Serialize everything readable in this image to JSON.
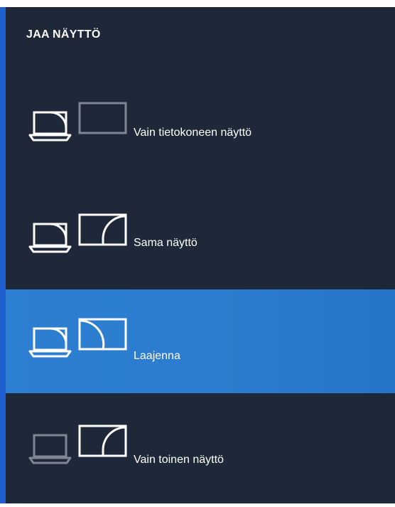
{
  "panel": {
    "title": "JAA NÄYTTÖ"
  },
  "options": [
    {
      "label": "Vain tietokoneen näyttö",
      "icon": "pc-screen-only-icon",
      "selected": false
    },
    {
      "label": "Sama näyttö",
      "icon": "duplicate-display-icon",
      "selected": false
    },
    {
      "label": "Laajenna",
      "icon": "extend-display-icon",
      "selected": true
    },
    {
      "label": "Vain toinen näyttö",
      "icon": "second-screen-only-icon",
      "selected": false
    }
  ],
  "colors": {
    "background": "#1f2838",
    "selected": "#2d7fd1",
    "accent": "#1f5fd0",
    "icon_active": "#ffffff",
    "icon_dim": "#7e8793"
  }
}
